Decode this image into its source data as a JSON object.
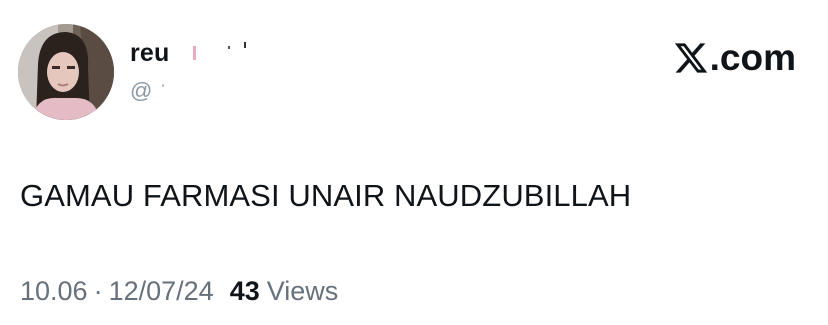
{
  "author": {
    "display_name": "reu",
    "handle": "@"
  },
  "brand": {
    "label": ".com",
    "icon": "x-logo-icon"
  },
  "tweet": {
    "text": "GAMAU FARMASI UNAIR NAUDZUBILLAH"
  },
  "meta": {
    "time": "10.06",
    "separator": "·",
    "date": "12/07/24",
    "views_count": "43",
    "views_label": "Views"
  },
  "colors": {
    "text_primary": "#0f1419",
    "text_secondary": "#66717c",
    "handle_gray": "#8b98a5"
  }
}
